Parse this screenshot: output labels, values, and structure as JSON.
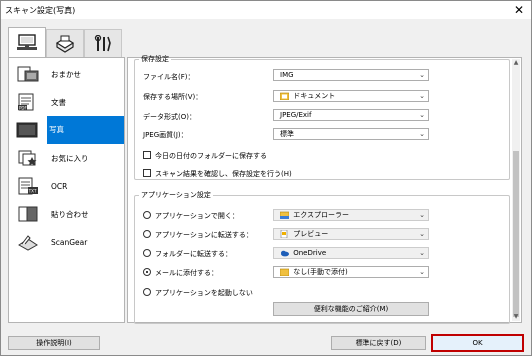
{
  "window": {
    "title": "スキャン設定(写真)",
    "close_glyph": "✕"
  },
  "tabs": [
    {
      "icon": "scanner-pc-icon",
      "selected": true
    },
    {
      "icon": "scanner-icon",
      "selected": false
    },
    {
      "icon": "tools-icon",
      "selected": false
    }
  ],
  "sidebar": {
    "items": [
      {
        "label": "おまかせ",
        "icon": "auto-scan-icon"
      },
      {
        "label": "文書",
        "icon": "document-icon"
      },
      {
        "label": "写真",
        "icon": "photo-icon",
        "selected": true
      },
      {
        "label": "お気に入り",
        "icon": "favorites-icon"
      },
      {
        "label": "OCR",
        "icon": "ocr-icon"
      },
      {
        "label": "貼り合わせ",
        "icon": "stitch-icon"
      },
      {
        "label": "ScanGear",
        "icon": "scangear-icon"
      }
    ]
  },
  "save": {
    "legend": "保存設定",
    "filename_label": "ファイル名(F)：",
    "filename_value": "IMG",
    "location_label": "保存する場所(V)：",
    "location_value": "ドキュメント",
    "format_label": "データ形式(O)：",
    "format_value": "JPEG/Exif",
    "quality_label": "JPEG画質(J)：",
    "quality_value": "標準",
    "date_folder_label": "今日の日付のフォルダーに保存する",
    "confirm_label": "スキャン結果を確認し、保存設定を行う(H)"
  },
  "app": {
    "legend": "アプリケーション設定",
    "open_label": "アプリケーションで開く：",
    "open_value": "エクスプローラー",
    "send_app_label": "アプリケーションに転送する：",
    "send_app_value": "プレビュー",
    "send_folder_label": "フォルダーに転送する：",
    "send_folder_value": "OneDrive",
    "mail_label": "メールに添付する：",
    "mail_value": "なし(手動で添付)",
    "none_label": "アプリケーションを起動しない",
    "intro_button": "便利な機能のご紹介(M)"
  },
  "footer": {
    "help_button": "操作説明(I)",
    "default_button": "標準に戻す(D)",
    "ok_button": "OK"
  },
  "scrollbar": {
    "up": "▲",
    "down": "▼"
  },
  "arrow_glyph": "⌄"
}
